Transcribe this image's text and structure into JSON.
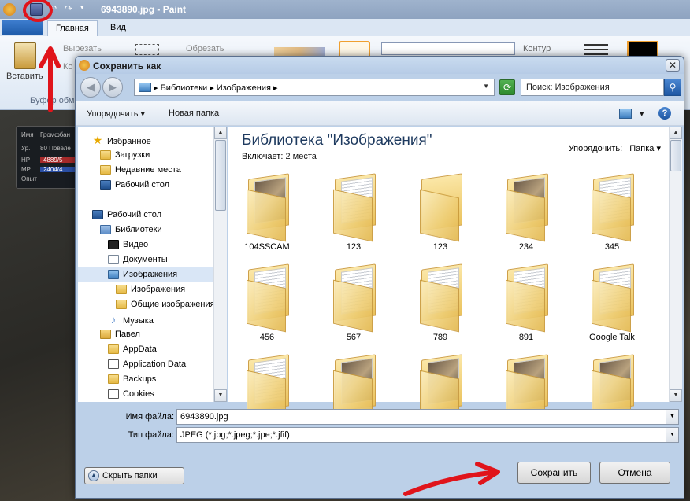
{
  "paint": {
    "title": "6943890.jpg - Paint",
    "tabs": [
      "Главная",
      "Вид"
    ],
    "ribbon": {
      "cut": "Вырезать",
      "copy": "Ко",
      "crop": "Обрезать",
      "paste": "Вставить",
      "clipboard_group": "Буфер обм",
      "outline": "Контур"
    },
    "hud": {
      "name_label": "Имя",
      "name_value": "Громфбан",
      "level_label": "Ур.",
      "level_value": "80 Повеле",
      "hp_label": "HP",
      "hp_value": "4889/5",
      "mp_label": "MP",
      "mp_value": "2404/4",
      "exp_label": "Опыт"
    }
  },
  "dialog": {
    "title": "Сохранить как",
    "close_glyph": "✕",
    "nav": {
      "back_glyph": "◀",
      "forward_glyph": "▶",
      "address": "▸ Библиотеки ▸ Изображения ▸",
      "refresh_glyph": "⟳",
      "search_placeholder": "Поиск: Изображения",
      "search_glyph": "⚲"
    },
    "toolbar": {
      "organize": "Упорядочить ▾",
      "new_folder": "Новая папка",
      "view_glyph": "▾",
      "help_glyph": "?"
    },
    "nav_pane": [
      {
        "label": "Избранное",
        "icon": "star-icon",
        "indent": 0
      },
      {
        "label": "Загрузки",
        "icon": "downloads-folder-icon",
        "indent": 1
      },
      {
        "label": "Недавние места",
        "icon": "recent-places-icon",
        "indent": 1
      },
      {
        "label": "Рабочий стол",
        "icon": "desktop-icon",
        "indent": 1
      },
      {
        "label": "",
        "icon": "",
        "indent": 0
      },
      {
        "label": "Рабочий стол",
        "icon": "desktop-icon",
        "indent": 0
      },
      {
        "label": "Библиотеки",
        "icon": "libraries-icon",
        "indent": 1
      },
      {
        "label": "Видео",
        "icon": "video-library-icon",
        "indent": 2
      },
      {
        "label": "Документы",
        "icon": "documents-library-icon",
        "indent": 2
      },
      {
        "label": "Изображения",
        "icon": "pictures-library-icon",
        "indent": 2,
        "selected": true
      },
      {
        "label": "Изображения",
        "icon": "folder-icon",
        "indent": 3
      },
      {
        "label": "Общие изображения",
        "icon": "folder-icon",
        "indent": 3
      },
      {
        "label": "Музыка",
        "icon": "music-library-icon",
        "indent": 2
      },
      {
        "label": "Павел",
        "icon": "user-folder-icon",
        "indent": 1
      },
      {
        "label": "AppData",
        "icon": "folder-icon",
        "indent": 2
      },
      {
        "label": "Application Data",
        "icon": "shortcut-folder-icon",
        "indent": 2
      },
      {
        "label": "Backups",
        "icon": "folder-icon",
        "indent": 2
      },
      {
        "label": "Cookies",
        "icon": "shortcut-folder-icon",
        "indent": 2
      }
    ],
    "content": {
      "title": "Библиотека \"Изображения\"",
      "includes_label": "Включает:",
      "includes_value": "2 места",
      "arrange_label": "Упорядочить:",
      "arrange_value": "Папка ▾",
      "folders": [
        {
          "name": "104SSCAM",
          "thumb": "photo"
        },
        {
          "name": "123",
          "thumb": "lines"
        },
        {
          "name": "123",
          "thumb": "empty"
        },
        {
          "name": "234",
          "thumb": "photo"
        },
        {
          "name": "345",
          "thumb": "lines"
        },
        {
          "name": "456",
          "thumb": "lines"
        },
        {
          "name": "567",
          "thumb": "lines"
        },
        {
          "name": "789",
          "thumb": "lines"
        },
        {
          "name": "891",
          "thumb": "lines"
        },
        {
          "name": "Google Talk",
          "thumb": "lines"
        },
        {
          "name": "",
          "thumb": "lines"
        },
        {
          "name": "",
          "thumb": "photo"
        },
        {
          "name": "",
          "thumb": "photo"
        },
        {
          "name": "",
          "thumb": "photo"
        },
        {
          "name": "",
          "thumb": "photo"
        }
      ]
    },
    "file_name_label": "Имя файла:",
    "file_name_value": "6943890.jpg",
    "file_type_label": "Тип файла:",
    "file_type_value": "JPEG (*.jpg;*.jpeg;*.jpe;*.jfif)",
    "hide_folders": "Скрыть папки",
    "save": "Сохранить",
    "cancel": "Отмена",
    "scroll_up": "▲",
    "scroll_down": "▼",
    "dropdown_glyph": "▼"
  },
  "annotation_color": "#e0141b"
}
